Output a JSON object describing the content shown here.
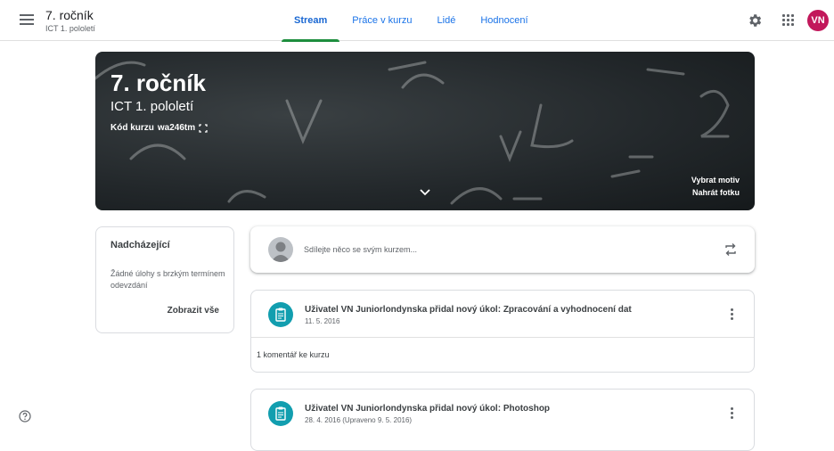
{
  "header": {
    "title": "7. ročník",
    "subtitle": "ICT 1. pololetí",
    "tabs": [
      {
        "label": "Stream",
        "active": true
      },
      {
        "label": "Práce v kurzu",
        "active": false
      },
      {
        "label": "Lidé",
        "active": false
      },
      {
        "label": "Hodnocení",
        "active": false
      }
    ],
    "avatar_initials": "VN",
    "avatar_color": "#c2185b",
    "icons": [
      "menu-icon",
      "gear-icon",
      "apps-grid-icon"
    ]
  },
  "banner": {
    "title": "7. ročník",
    "section": "ICT 1. pololetí",
    "code_label": "Kód kurzu",
    "code_value": "wa246tm",
    "select_theme": "Vybrat motiv",
    "upload_photo": "Nahrát fotku"
  },
  "upcoming": {
    "title": "Nadcházející",
    "empty_text": "Žádné úlohy s brzkým termínem odevzdání",
    "view_all": "Zobrazit vše"
  },
  "share": {
    "placeholder": "Sdílejte něco se svým kurzem..."
  },
  "posts": [
    {
      "title": "Uživatel VN Juniorlondynska přidal nový úkol: Zpracování a vyhodnocení dat",
      "date": "11. 5. 2016",
      "comments": "1 komentář ke kurzu"
    },
    {
      "title": "Uživatel VN Juniorlondynska přidal nový úkol: Photoshop",
      "date": "28. 4. 2016 (Upraveno 9. 5. 2016)"
    }
  ],
  "colors": {
    "accent": "#1967d2",
    "tab_indicator": "#1e8e3e",
    "assignment_icon_bg": "#129eaf"
  }
}
